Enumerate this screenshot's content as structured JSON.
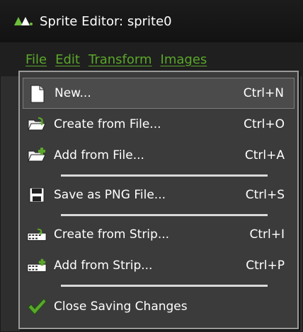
{
  "window": {
    "title": "Sprite Editor: sprite0"
  },
  "menubar": {
    "items": [
      "File",
      "Edit",
      "Transform",
      "Images"
    ]
  },
  "menu": {
    "items": [
      {
        "label": "New...",
        "shortcut": "Ctrl+N",
        "icon": "new-page-icon"
      },
      {
        "label": "Create from File...",
        "shortcut": "Ctrl+O",
        "icon": "folder-open-icon"
      },
      {
        "label": "Add from File...",
        "shortcut": "Ctrl+A",
        "icon": "folder-add-icon"
      },
      {
        "label": "Save as PNG File...",
        "shortcut": "Ctrl+S",
        "icon": "save-icon"
      },
      {
        "label": "Create from Strip...",
        "shortcut": "Ctrl+I",
        "icon": "strip-create-icon"
      },
      {
        "label": "Add from Strip...",
        "shortcut": "Ctrl+P",
        "icon": "strip-add-icon"
      },
      {
        "label": "Close Saving Changes",
        "shortcut": "",
        "icon": "checkmark-icon"
      }
    ]
  },
  "colors": {
    "menu_accent": "#5aa82a",
    "background": "#2e2e2e"
  }
}
